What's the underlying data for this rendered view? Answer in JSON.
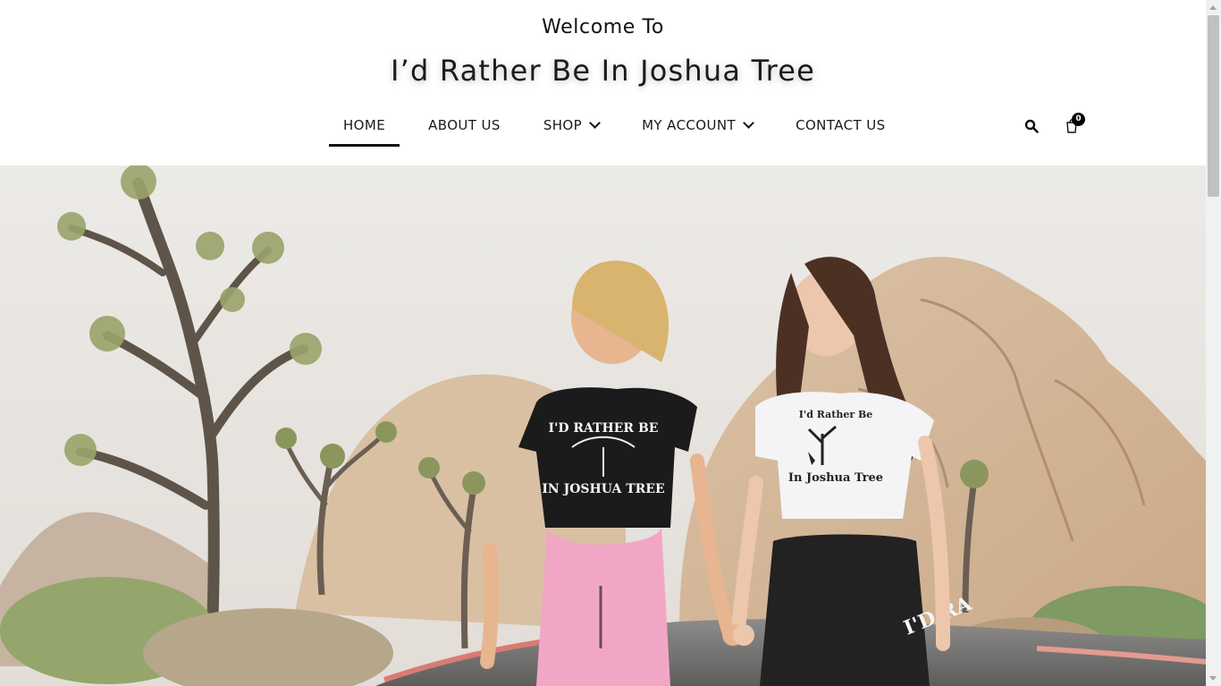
{
  "header": {
    "welcome": "Welcome To",
    "site_title": "I’d Rather Be In Joshua Tree"
  },
  "nav": {
    "items": [
      {
        "label": "HOME",
        "active": true,
        "has_dropdown": false
      },
      {
        "label": "ABOUT US",
        "active": false,
        "has_dropdown": false
      },
      {
        "label": "SHOP",
        "active": false,
        "has_dropdown": true
      },
      {
        "label": "MY ACCOUNT",
        "active": false,
        "has_dropdown": true
      },
      {
        "label": "CONTACT US",
        "active": false,
        "has_dropdown": false
      }
    ]
  },
  "icons": {
    "search": "search-icon",
    "cart": "cart-icon",
    "dropdown": "chevron-down-icon"
  },
  "cart": {
    "count": "0"
  },
  "hero": {
    "shirt_left_top": "I'D RATHER BE",
    "shirt_left_bottom": "IN JOSHUA TREE",
    "shirt_right_top": "I'd Rather Be",
    "shirt_right_bottom": "In Joshua Tree",
    "legging_text": "I'D RA"
  },
  "colors": {
    "accent": "#111111",
    "background": "#ffffff"
  }
}
